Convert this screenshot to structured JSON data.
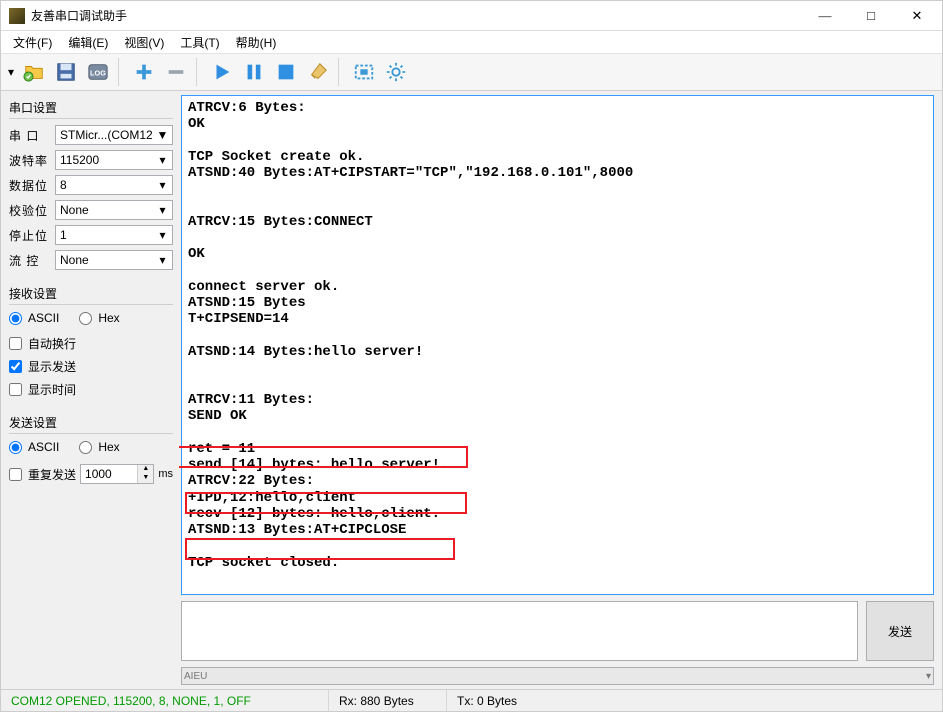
{
  "window": {
    "title": "友善串口调试助手"
  },
  "menu": {
    "file": "文件(F)",
    "edit": "编辑(E)",
    "view": "视图(V)",
    "tools": "工具(T)",
    "help": "帮助(H)"
  },
  "serial": {
    "group": "串口设置",
    "port_label": "串  口",
    "port_value": "STMicr...(COM12",
    "baud_label": "波特率",
    "baud_value": "115200",
    "databits_label": "数据位",
    "databits_value": "8",
    "parity_label": "校验位",
    "parity_value": "None",
    "stopbits_label": "停止位",
    "stopbits_value": "1",
    "flow_label": "流  控",
    "flow_value": "None"
  },
  "recv": {
    "group": "接收设置",
    "ascii": "ASCII",
    "hex": "Hex",
    "autowrap": "自动换行",
    "showsend": "显示发送",
    "showtime": "显示时间"
  },
  "send": {
    "group": "发送设置",
    "ascii": "ASCII",
    "hex": "Hex",
    "repeat": "重复发送",
    "interval": "1000",
    "unit": "ms",
    "btn": "发送"
  },
  "output": "ATRCV:6 Bytes:\nOK\n\nTCP Socket create ok.\nATSND:40 Bytes:AT+CIPSTART=\"TCP\",\"192.168.0.101\",8000\n\n\nATRCV:15 Bytes:CONNECT\n\nOK\n\nconnect server ok.\nATSND:15 Bytes\nT+CIPSEND=14\n\nATSND:14 Bytes:hello server!\n\n\nATRCV:11 Bytes:\nSEND OK\n\nret = 11\nsend [14] bytes: hello server!.\nATRCV:22 Bytes:\n+IPD,12:hello,client\nrecv [12] bytes: hello,client.\nATSND:13 Bytes:AT+CIPCLOSE\n\nTCP socket closed.",
  "mini_combo": "AIEU",
  "status": {
    "conn": "COM12 OPENED, 115200, 8, NONE, 1, OFF",
    "rx": "Rx: 880 Bytes",
    "tx": "Tx: 0 Bytes"
  }
}
